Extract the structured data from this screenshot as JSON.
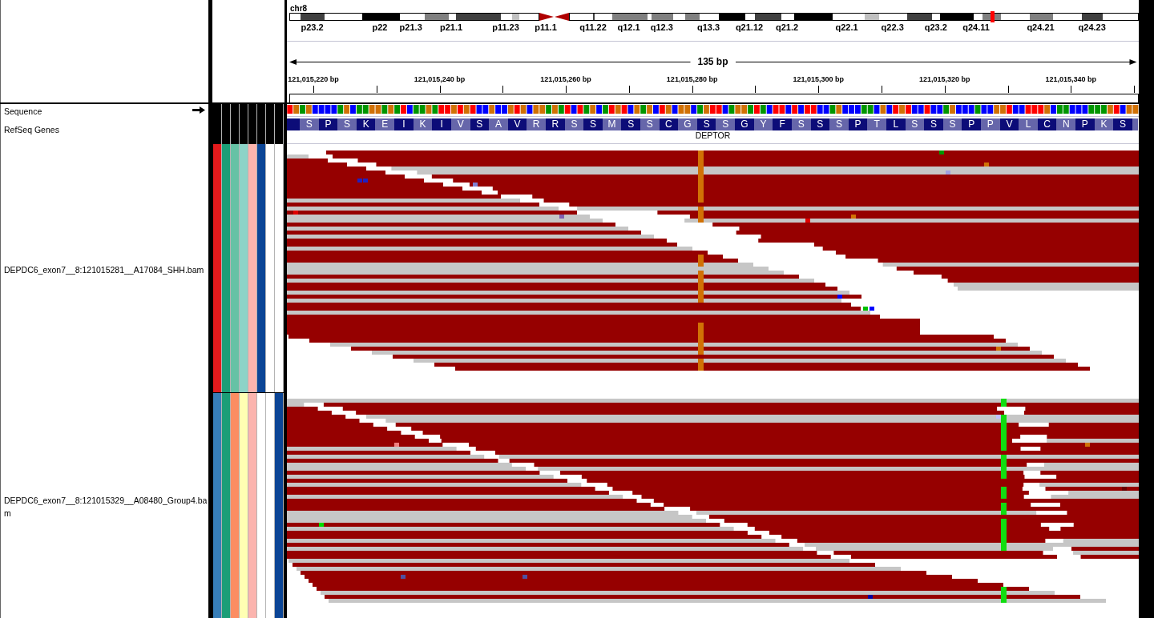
{
  "header": {
    "chromosome": "chr8",
    "bands": [
      "p23.2",
      "p22",
      "p21.3",
      "p21.1",
      "p11.23",
      "p11.1",
      "q11.22",
      "q12.1",
      "q12.3",
      "q13.3",
      "q21.12",
      "q21.2",
      "q22.1",
      "q22.3",
      "q23.2",
      "q24.11",
      "q24.21",
      "q24.23"
    ],
    "span": "135 bp",
    "ticks": [
      "121,015,220 bp",
      "121,015,240 bp",
      "121,015,260 bp",
      "121,015,280 bp",
      "121,015,300 bp",
      "121,015,320 bp",
      "121,015,340 bp"
    ]
  },
  "tracks": [
    {
      "kind": "sequence",
      "name": "Sequence",
      "bases": [
        {
          "color": "#ff0000"
        },
        {
          "color": "#d17105"
        },
        {
          "color": "#009600"
        },
        {
          "color": "#d17105"
        },
        {
          "color": "#0000ff"
        },
        {
          "color": "#0000ff"
        },
        {
          "color": "#0000ff"
        },
        {
          "color": "#0000ff"
        },
        {
          "color": "#009600"
        },
        {
          "color": "#d17105"
        },
        {
          "color": "#0000ff"
        },
        {
          "color": "#009600"
        },
        {
          "color": "#009600"
        },
        {
          "color": "#d17105"
        },
        {
          "color": "#d17105"
        },
        {
          "color": "#009600"
        },
        {
          "color": "#d17105"
        },
        {
          "color": "#009600"
        },
        {
          "color": "#ff0000"
        },
        {
          "color": "#0000ff"
        },
        {
          "color": "#009600"
        },
        {
          "color": "#009600"
        },
        {
          "color": "#d17105"
        },
        {
          "color": "#009600"
        },
        {
          "color": "#ff0000"
        },
        {
          "color": "#ff0000"
        },
        {
          "color": "#d17105"
        },
        {
          "color": "#ff0000"
        },
        {
          "color": "#d17105"
        },
        {
          "color": "#ff0000"
        },
        {
          "color": "#0000ff"
        },
        {
          "color": "#0000ff"
        },
        {
          "color": "#d17105"
        },
        {
          "color": "#0000ff"
        },
        {
          "color": "#0000ff"
        },
        {
          "color": "#d17105"
        },
        {
          "color": "#ff0000"
        },
        {
          "color": "#d17105"
        },
        {
          "color": "#0000ff"
        },
        {
          "color": "#d17105"
        },
        {
          "color": "#d17105"
        },
        {
          "color": "#009600"
        },
        {
          "color": "#d17105"
        },
        {
          "color": "#009600"
        },
        {
          "color": "#ff0000"
        },
        {
          "color": "#0000ff"
        },
        {
          "color": "#ff0000"
        },
        {
          "color": "#009600"
        },
        {
          "color": "#d17105"
        },
        {
          "color": "#0000ff"
        },
        {
          "color": "#009600"
        },
        {
          "color": "#ff0000"
        },
        {
          "color": "#d17105"
        },
        {
          "color": "#ff0000"
        },
        {
          "color": "#0000ff"
        },
        {
          "color": "#d17105"
        },
        {
          "color": "#009600"
        },
        {
          "color": "#d17105"
        },
        {
          "color": "#0000ff"
        },
        {
          "color": "#ff0000"
        },
        {
          "color": "#d17105"
        },
        {
          "color": "#0000ff"
        },
        {
          "color": "#d17105"
        },
        {
          "color": "#d17105"
        },
        {
          "color": "#0000ff"
        },
        {
          "color": "#009600"
        },
        {
          "color": "#d17105"
        },
        {
          "color": "#ff0000"
        },
        {
          "color": "#ff0000"
        },
        {
          "color": "#0000ff"
        },
        {
          "color": "#009600"
        },
        {
          "color": "#d17105"
        },
        {
          "color": "#d17105"
        },
        {
          "color": "#009600"
        },
        {
          "color": "#ff0000"
        },
        {
          "color": "#009600"
        },
        {
          "color": "#0000ff"
        },
        {
          "color": "#ff0000"
        },
        {
          "color": "#ff0000"
        },
        {
          "color": "#0000ff"
        },
        {
          "color": "#ff0000"
        },
        {
          "color": "#0000ff"
        },
        {
          "color": "#ff0000"
        },
        {
          "color": "#ff0000"
        },
        {
          "color": "#0000ff"
        },
        {
          "color": "#0000ff"
        },
        {
          "color": "#009600"
        },
        {
          "color": "#d17105"
        },
        {
          "color": "#0000ff"
        },
        {
          "color": "#0000ff"
        },
        {
          "color": "#0000ff"
        },
        {
          "color": "#009600"
        },
        {
          "color": "#009600"
        },
        {
          "color": "#0000ff"
        },
        {
          "color": "#d17105"
        },
        {
          "color": "#0000ff"
        },
        {
          "color": "#ff0000"
        },
        {
          "color": "#d17105"
        },
        {
          "color": "#ff0000"
        },
        {
          "color": "#0000ff"
        },
        {
          "color": "#0000ff"
        },
        {
          "color": "#ff0000"
        },
        {
          "color": "#0000ff"
        },
        {
          "color": "#0000ff"
        },
        {
          "color": "#009600"
        },
        {
          "color": "#d17105"
        },
        {
          "color": "#0000ff"
        },
        {
          "color": "#0000ff"
        },
        {
          "color": "#0000ff"
        },
        {
          "color": "#009600"
        },
        {
          "color": "#0000ff"
        },
        {
          "color": "#0000ff"
        },
        {
          "color": "#d17105"
        },
        {
          "color": "#d17105"
        },
        {
          "color": "#ff0000"
        },
        {
          "color": "#0000ff"
        },
        {
          "color": "#0000ff"
        },
        {
          "color": "#ff0000"
        },
        {
          "color": "#ff0000"
        },
        {
          "color": "#ff0000"
        },
        {
          "color": "#d17105"
        },
        {
          "color": "#0000ff"
        },
        {
          "color": "#009600"
        },
        {
          "color": "#009600"
        },
        {
          "color": "#0000ff"
        },
        {
          "color": "#0000ff"
        },
        {
          "color": "#0000ff"
        },
        {
          "color": "#009600"
        },
        {
          "color": "#009600"
        },
        {
          "color": "#009600"
        },
        {
          "color": "#d17105"
        },
        {
          "color": "#ff0000"
        },
        {
          "color": "#0000ff"
        },
        {
          "color": "#d17105"
        },
        {
          "color": "#d17105"
        }
      ]
    },
    {
      "kind": "genes",
      "name": "RefSeq Genes",
      "amino_acids": [
        "S",
        "P",
        "S",
        "K",
        "E",
        "I",
        "K",
        "I",
        "V",
        "S",
        "A",
        "V",
        "R",
        "R",
        "S",
        "S",
        "M",
        "S",
        "S",
        "C",
        "G",
        "S",
        "S",
        "G",
        "Y",
        "F",
        "S",
        "S",
        "S",
        "P",
        "T",
        "L",
        "S",
        "S",
        "S",
        "P",
        "P",
        "V",
        "L",
        "C",
        "N",
        "P",
        "K",
        "S"
      ],
      "gene": "DEPTOR"
    },
    {
      "kind": "alignment",
      "name": "DEPDC6_exon7__8:121015281__A17084_SHH.bam",
      "attributes": [
        {
          "color": "#e41a1c"
        },
        {
          "color": "#1b9e77"
        },
        {
          "color": "#66c2a5"
        },
        {
          "color": "#8dd3c7"
        },
        {
          "color": "#fbb4ae"
        },
        {
          "color": "#0b4596"
        },
        {
          "color": "#ffffff"
        },
        {
          "color": "#ffffff"
        }
      ]
    },
    {
      "kind": "alignment",
      "name": "DEPDC6_exon7__8:121015329__A08480_Group4.bam",
      "attributes": [
        {
          "color": "#377eb8"
        },
        {
          "color": "#1b9e77"
        },
        {
          "color": "#fc8d62"
        },
        {
          "color": "#ffffb3"
        },
        {
          "color": "#fbb4ae"
        },
        {
          "color": "#ffffff"
        },
        {
          "color": "#ffffff"
        },
        {
          "color": "#0b4596"
        }
      ]
    }
  ]
}
